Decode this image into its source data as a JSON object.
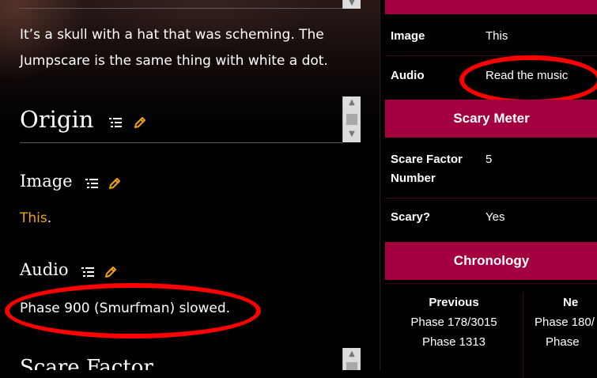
{
  "main": {
    "description": "It’s a skull with a hat that was scheming. The Jumpscare is the same thing with white a dot.",
    "description_line1": "It’s a skull with a hat that was scheming. The",
    "description_line2": "Jumpscare is the same thing with white a dot.",
    "origin_heading": "Origin",
    "image_heading": "Image",
    "image_link": "This",
    "image_suffix": ".",
    "audio_heading": "Audio",
    "audio_text": "Phase 900 (Smurfman) slowed.",
    "next_heading": "Scare Factor"
  },
  "infobox": {
    "image_label": "Image",
    "image_value": "This",
    "audio_label": "Audio",
    "audio_value": "Read the music",
    "scary_meter_header": "Scary Meter",
    "scare_factor_label_1": "Scare Factor",
    "scare_factor_label_2": "Number",
    "scare_factor_value": "5",
    "scary_label": "Scary?",
    "scary_value": "Yes",
    "chronology_header": "Chronology",
    "previous_label": "Previous",
    "previous_1": "Phase 178/3015",
    "previous_2": "Phase 1313",
    "next_label": "Ne",
    "next_1": "Phase 180/",
    "next_2": "Phase"
  },
  "colors": {
    "accent_link": "#f0a30a",
    "infobox_header": "#a3003f",
    "annotation": "#ff0000"
  },
  "icons": [
    "list-icon",
    "pencil-edit-icon",
    "scroll-up-arrow-icon",
    "scroll-down-arrow-icon"
  ]
}
